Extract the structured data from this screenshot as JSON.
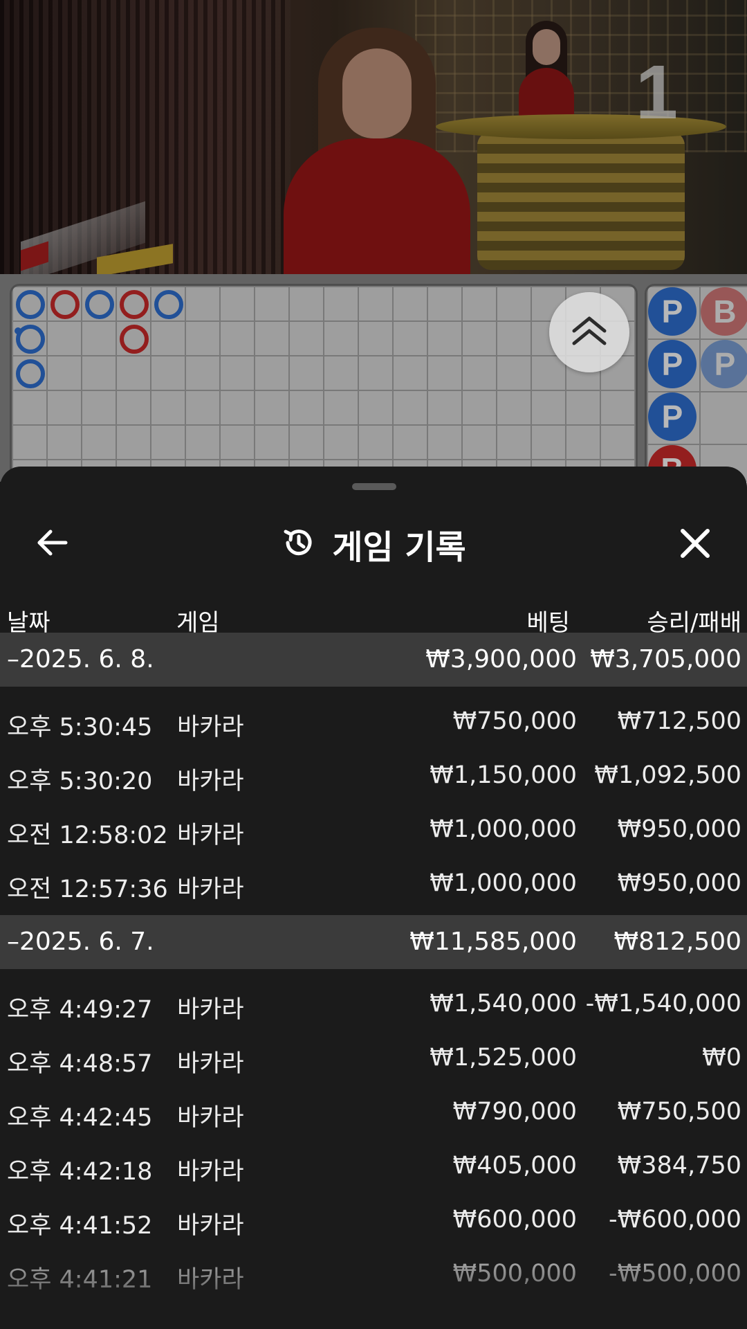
{
  "video": {
    "table_number": "1"
  },
  "big_road": {
    "columns": [
      [
        "P",
        "P",
        "P"
      ],
      [
        "B"
      ],
      [
        "P"
      ],
      [
        "B",
        "B"
      ],
      [
        "P"
      ]
    ]
  },
  "bead_road": {
    "columns": [
      [
        "P",
        "P",
        "P",
        "B"
      ],
      [
        "B",
        "P"
      ]
    ]
  },
  "header": {
    "title": "게임 기록",
    "icons": [
      "arrow-left-icon",
      "history-icon",
      "close-icon",
      "chevrons-up-icon"
    ]
  },
  "columns": {
    "date": "날짜",
    "game": "게임",
    "bet": "베팅",
    "win_loss": "승리/패배"
  },
  "groups": [
    {
      "date": "–2025. 6. 8.",
      "bet_total": "₩3,900,000",
      "win_loss_total": "₩3,705,000",
      "rows": [
        {
          "time": "오후 5:30:45",
          "game": "바카라",
          "bet": "₩750,000",
          "win_loss": "₩712,500"
        },
        {
          "time": "오후 5:30:20",
          "game": "바카라",
          "bet": "₩1,150,000",
          "win_loss": "₩1,092,500"
        },
        {
          "time": "오전 12:58:02",
          "game": "바카라",
          "bet": "₩1,000,000",
          "win_loss": "₩950,000"
        },
        {
          "time": "오전 12:57:36",
          "game": "바카라",
          "bet": "₩1,000,000",
          "win_loss": "₩950,000"
        }
      ]
    },
    {
      "date": "–2025. 6. 7.",
      "bet_total": "₩11,585,000",
      "win_loss_total": "₩812,500",
      "rows": [
        {
          "time": "오후 4:49:27",
          "game": "바카라",
          "bet": "₩1,540,000",
          "win_loss": "-₩1,540,000"
        },
        {
          "time": "오후 4:48:57",
          "game": "바카라",
          "bet": "₩1,525,000",
          "win_loss": "₩0"
        },
        {
          "time": "오후 4:42:45",
          "game": "바카라",
          "bet": "₩790,000",
          "win_loss": "₩750,500"
        },
        {
          "time": "오후 4:42:18",
          "game": "바카라",
          "bet": "₩405,000",
          "win_loss": "₩384,750"
        },
        {
          "time": "오후 4:41:52",
          "game": "바카라",
          "bet": "₩600,000",
          "win_loss": "-₩600,000"
        },
        {
          "time": "오후 4:41:21",
          "game": "바카라",
          "bet": "₩500,000",
          "win_loss": "-₩500,000"
        }
      ]
    }
  ],
  "colors": {
    "player": "#2f6fd1",
    "banker": "#cc2a2a",
    "sheet_bg": "#1b1b1b",
    "group_bg": "#3b3b3b"
  }
}
